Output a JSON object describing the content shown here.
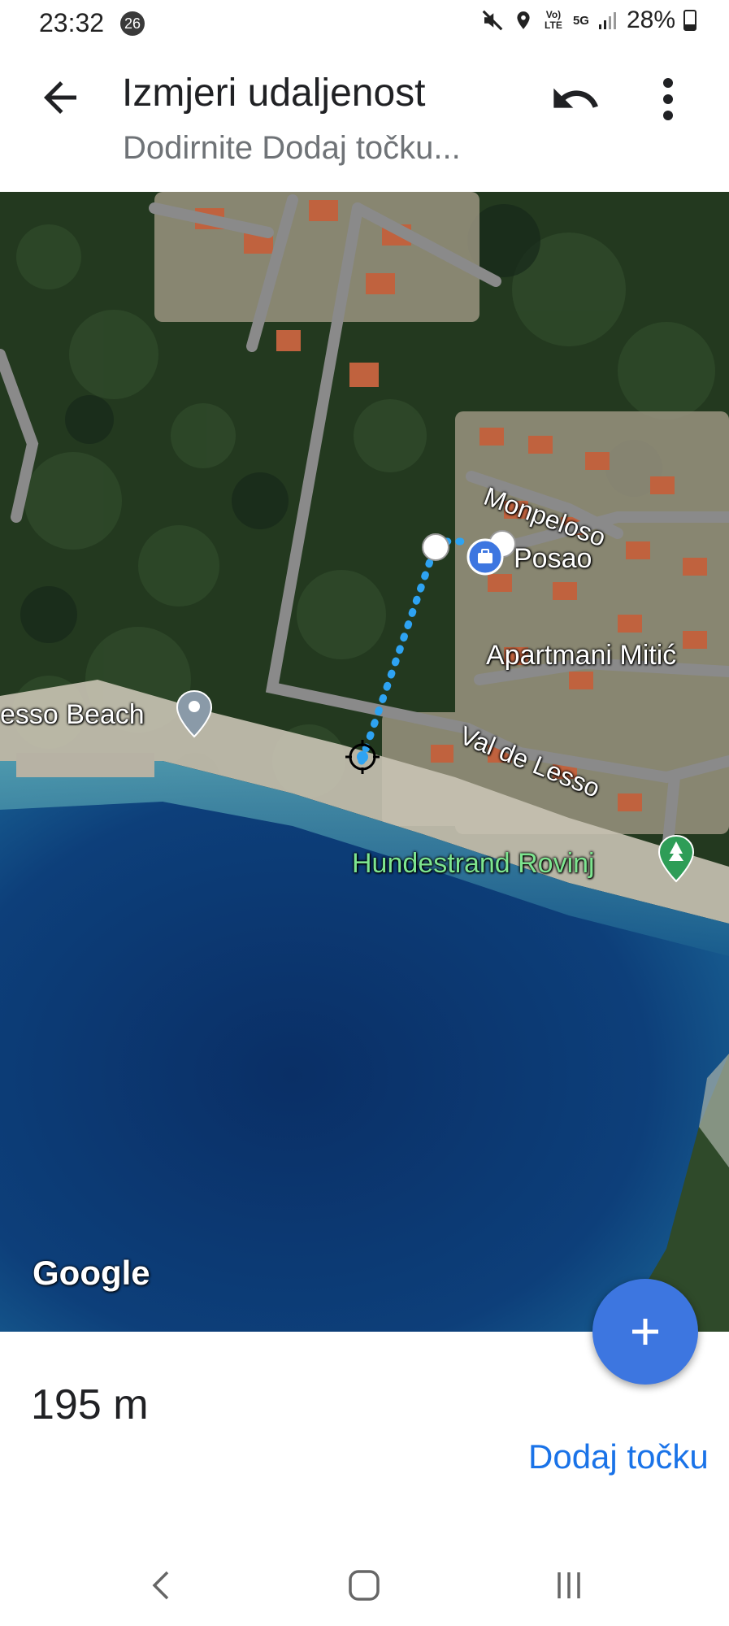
{
  "status_bar": {
    "time": "23:32",
    "notification_count": "26",
    "network_volte": "Vo) LTE",
    "network_5g": "5G",
    "battery": "28%",
    "icons": [
      "mute-icon",
      "location-icon",
      "volte-icon",
      "5g-icon",
      "signal-icon",
      "battery-icon"
    ]
  },
  "app_bar": {
    "title": "Izmjeri udaljenost",
    "subtitle": "Dodirnite Dodaj točku...",
    "icons": [
      "back-arrow-icon",
      "undo-icon",
      "more-vert-icon"
    ]
  },
  "map": {
    "labels": {
      "monpeloso": "Monpeloso",
      "posao": "Posao",
      "apartmani": "Apartmani Mitić",
      "lesso_beach": "esso Beach",
      "val_de_lesso": "Val de Lesso",
      "hundestrand": "Hundestrand Rovinj"
    },
    "google_logo": "Google",
    "colors": {
      "sea": "#0d3f7a",
      "forest": "#1f3a1e",
      "route": "#2ea3f2",
      "work_pin": "#3d76e0",
      "park_pin": "#2e9d57"
    }
  },
  "fabs": {
    "locate_icon": "my-location-icon",
    "add_icon": "plus-icon"
  },
  "sheet": {
    "distance": "195 m",
    "add_point": "Dodaj točku"
  },
  "nav_bar": {
    "icons": [
      "nav-back-icon",
      "nav-home-icon",
      "nav-recents-icon"
    ]
  }
}
